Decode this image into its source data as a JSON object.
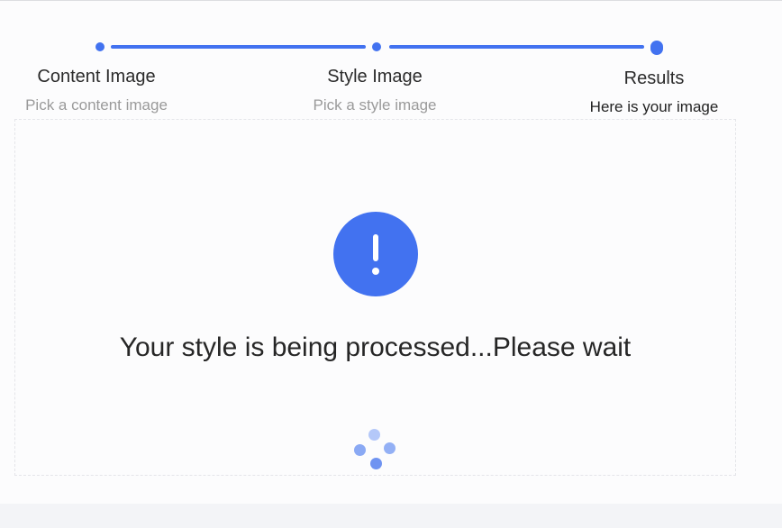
{
  "steps": [
    {
      "title": "Content Image",
      "description": "Pick a content image",
      "status": "finished"
    },
    {
      "title": "Style Image",
      "description": "Pick a style image",
      "status": "finished"
    },
    {
      "title": "Results",
      "description": "Here is your image",
      "status": "current"
    }
  ],
  "result": {
    "icon": "exclamation-circle-icon",
    "message": "Your style is being processed...Please wait",
    "spinner_icon": "loading-spinner-icon"
  },
  "colors": {
    "accent": "#4272f0",
    "muted_text": "#9a9a9a",
    "text": "#2b2b2b"
  }
}
